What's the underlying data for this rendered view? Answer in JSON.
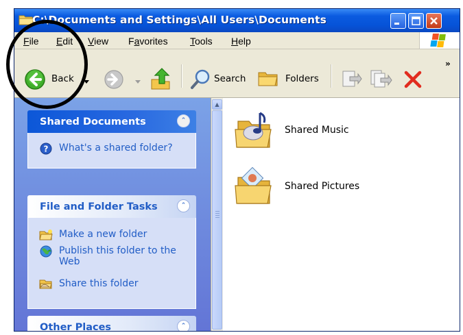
{
  "window": {
    "title": "C:\\Documents and Settings\\All Users\\Documents",
    "controls": [
      "minimize",
      "maximize",
      "close"
    ]
  },
  "menubar": {
    "items": [
      {
        "label": "File",
        "accel": "F",
        "rest": "ile"
      },
      {
        "label": "Edit",
        "accel": "E",
        "rest": "dit"
      },
      {
        "label": "View",
        "accel": "V",
        "rest": "iew"
      },
      {
        "label": "Favorites",
        "accel": "a",
        "pre": "F",
        "rest": "vorites"
      },
      {
        "label": "Tools",
        "accel": "T",
        "rest": "ools"
      },
      {
        "label": "Help",
        "accel": "H",
        "rest": "elp"
      }
    ]
  },
  "toolbar": {
    "back_label": "Back",
    "search_label": "Search",
    "folders_label": "Folders",
    "more": "»"
  },
  "taskpane": {
    "shared_documents": {
      "title": "Shared Documents",
      "links": [
        "What's a shared folder?"
      ]
    },
    "file_folder_tasks": {
      "title": "File and Folder Tasks",
      "links": [
        "Make a new folder",
        "Publish this folder to the Web",
        "Share this folder"
      ]
    },
    "other_places": {
      "title": "Other Places"
    }
  },
  "content": {
    "items": [
      {
        "label": "Shared Music",
        "icon": "shared-music-folder-icon"
      },
      {
        "label": "Shared Pictures",
        "icon": "shared-pictures-folder-icon"
      }
    ]
  },
  "colors": {
    "titlebar": "#0653d8",
    "task_link": "#215dc6",
    "pane_bg": "#7ba2e7",
    "annotation": "#000000"
  }
}
